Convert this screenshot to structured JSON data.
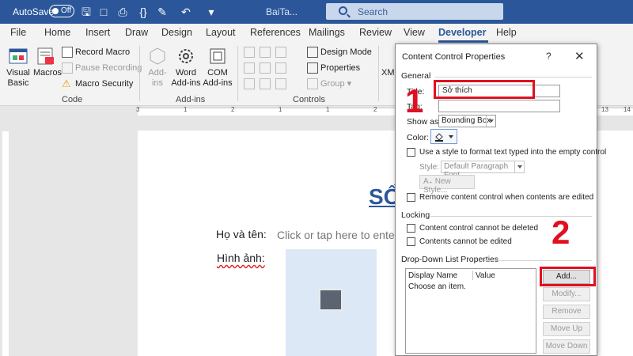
{
  "titlebar": {
    "autosave_label": "AutoSave",
    "toggle_state": "Off",
    "doc_name": "BaiTa...",
    "search_placeholder": "Search"
  },
  "menu": {
    "tabs": [
      "File",
      "Home",
      "Insert",
      "Draw",
      "Design",
      "Layout",
      "References",
      "Mailings",
      "Review",
      "View",
      "Developer",
      "Help"
    ],
    "active": "Developer"
  },
  "ribbon": {
    "code": {
      "visual_basic": "Visual\nBasic",
      "macros": "Macros",
      "record_macro": "Record Macro",
      "pause_recording": "Pause Recording",
      "macro_security": "Macro Security",
      "group_label": "Code"
    },
    "addins": {
      "add_ins": "Add-\nins",
      "word_addins": "Word\nAdd-ins",
      "com_addins": "COM\nAdd-ins",
      "group_label": "Add-ins"
    },
    "controls": {
      "design_mode": "Design Mode",
      "properties": "Properties",
      "group": "Group",
      "group_label": "Controls"
    },
    "xml_partial": "XM"
  },
  "ruler": {
    "labels": [
      "3",
      "1",
      "2",
      "1",
      "1",
      "2",
      "13",
      "14"
    ]
  },
  "document": {
    "title": "SỔ",
    "label_name": "Họ và tên:",
    "placeholder": "Click or tap here to ente",
    "label_image": "Hình ảnh:"
  },
  "dialog": {
    "title": "Content Control Properties",
    "help": "?",
    "close": "✕",
    "general": "General",
    "title_label": "Title:",
    "title_value": "Sở thích",
    "tag_label": "Tag:",
    "tag_value": "",
    "show_as_label": "Show as:",
    "show_as_value": "Bounding Box",
    "color_label": "Color:",
    "use_style_label": "Use a style to format text typed into the empty control",
    "style_label": "Style:",
    "style_value": "Default Paragraph Font",
    "new_style": "New Style...",
    "remove_control_label": "Remove content control when contents are edited",
    "locking": "Locking",
    "cannot_delete": "Content control cannot be deleted",
    "cannot_edit": "Contents cannot be edited",
    "dropdown_section": "Drop-Down List Properties",
    "col_display": "Display Name",
    "col_value": "Value",
    "list_item": "Choose an item.",
    "buttons": {
      "add": "Add...",
      "modify": "Modify...",
      "remove": "Remove",
      "move_up": "Move Up",
      "move_down": "Move Down"
    }
  },
  "annotations": {
    "step1": "1",
    "step2": "2",
    "color": "#e01020"
  }
}
